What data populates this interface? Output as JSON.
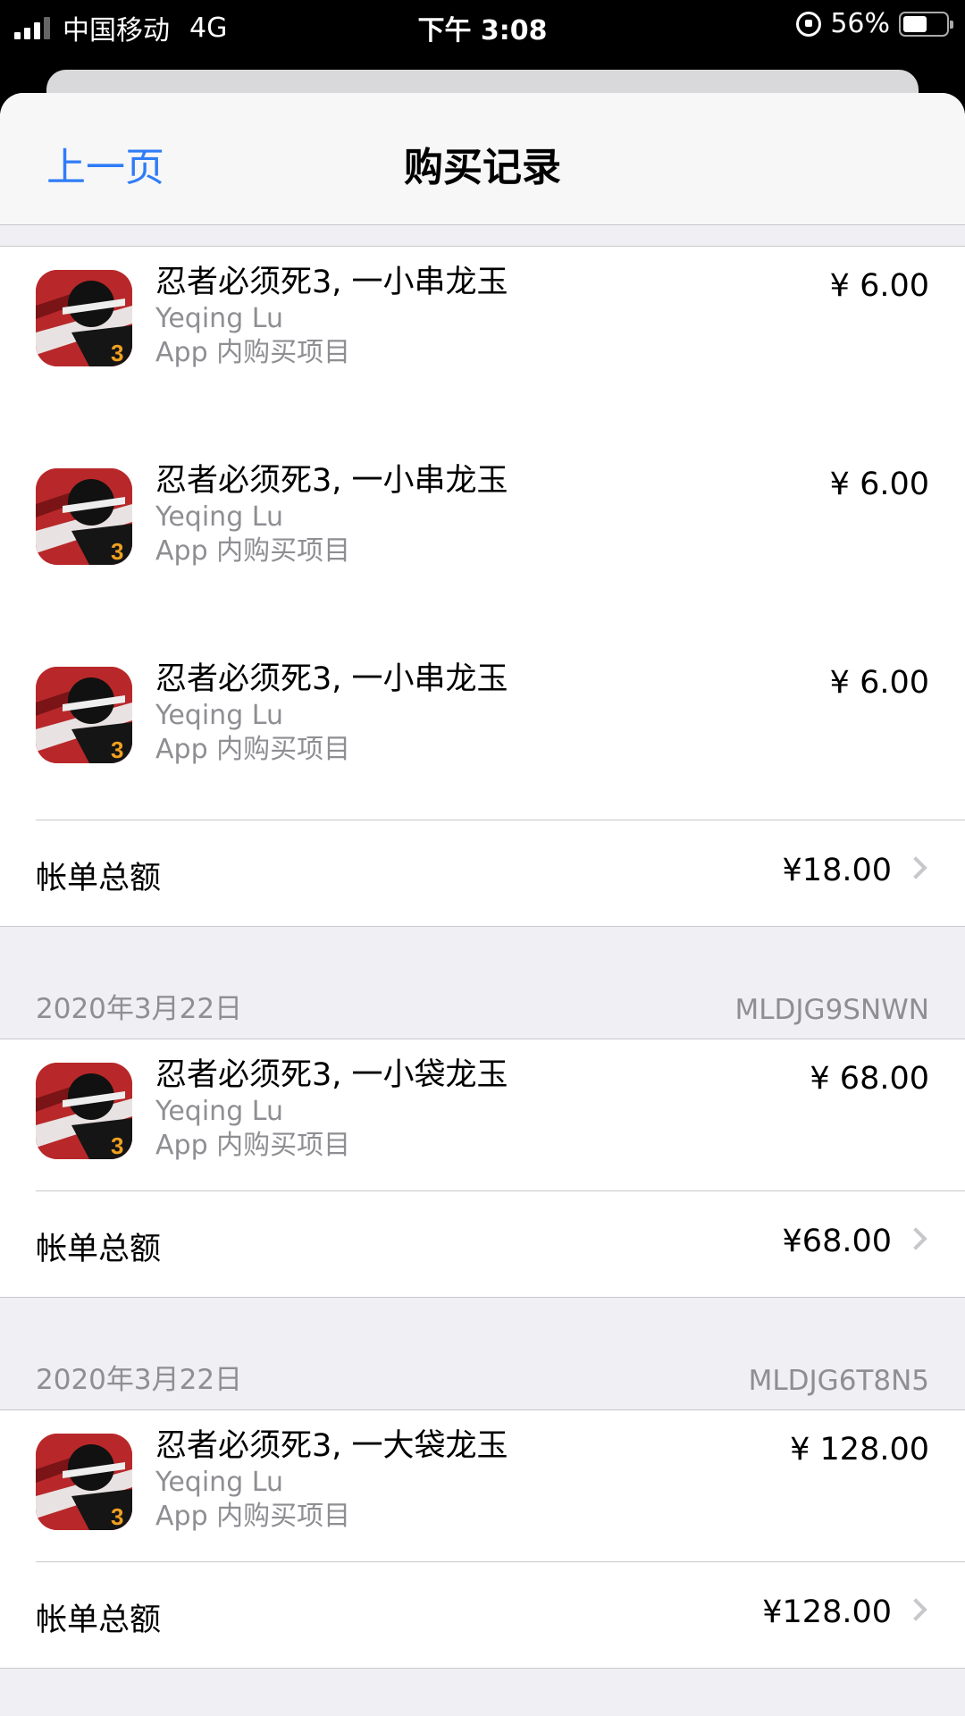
{
  "status_bar": {
    "carrier": "中国移动",
    "network": "4G",
    "time": "下午 3:08",
    "battery_percent": "56%",
    "battery_level": 0.56
  },
  "nav": {
    "back_label": "上一页",
    "title": "购买记录"
  },
  "top_group": {
    "items": [
      {
        "name": "忍者必须死3, 一小串龙玉",
        "developer": "Yeqing Lu",
        "kind": "App 内购买项目",
        "price": "¥ 6.00"
      },
      {
        "name": "忍者必须死3, 一小串龙玉",
        "developer": "Yeqing Lu",
        "kind": "App 内购买项目",
        "price": "¥ 6.00"
      },
      {
        "name": "忍者必须死3, 一小串龙玉",
        "developer": "Yeqing Lu",
        "kind": "App 内购买项目",
        "price": "¥ 6.00"
      }
    ],
    "total_label": "帐单总额",
    "total_amount": "¥18.00"
  },
  "group2": {
    "date": "2020年3月22日",
    "order_id": "MLDJG9SNWN",
    "item": {
      "name": "忍者必须死3, 一小袋龙玉",
      "developer": "Yeqing Lu",
      "kind": "App 内购买项目",
      "price": "¥ 68.00"
    },
    "total_label": "帐单总额",
    "total_amount": "¥68.00"
  },
  "group3": {
    "date": "2020年3月22日",
    "order_id": "MLDJG6T8N5",
    "item": {
      "name": "忍者必须死3, 一大袋龙玉",
      "developer": "Yeqing Lu",
      "kind": "App 内购买项目",
      "price": "¥ 128.00"
    },
    "total_label": "帐单总额",
    "total_amount": "¥128.00"
  },
  "colors": {
    "accent": "#2f7cf6",
    "secondary_text": "#8e8e93",
    "background": "#efeff4"
  },
  "icons": {
    "app_icon": "ninja-game-icon",
    "chevron": "chevron-right-icon"
  }
}
